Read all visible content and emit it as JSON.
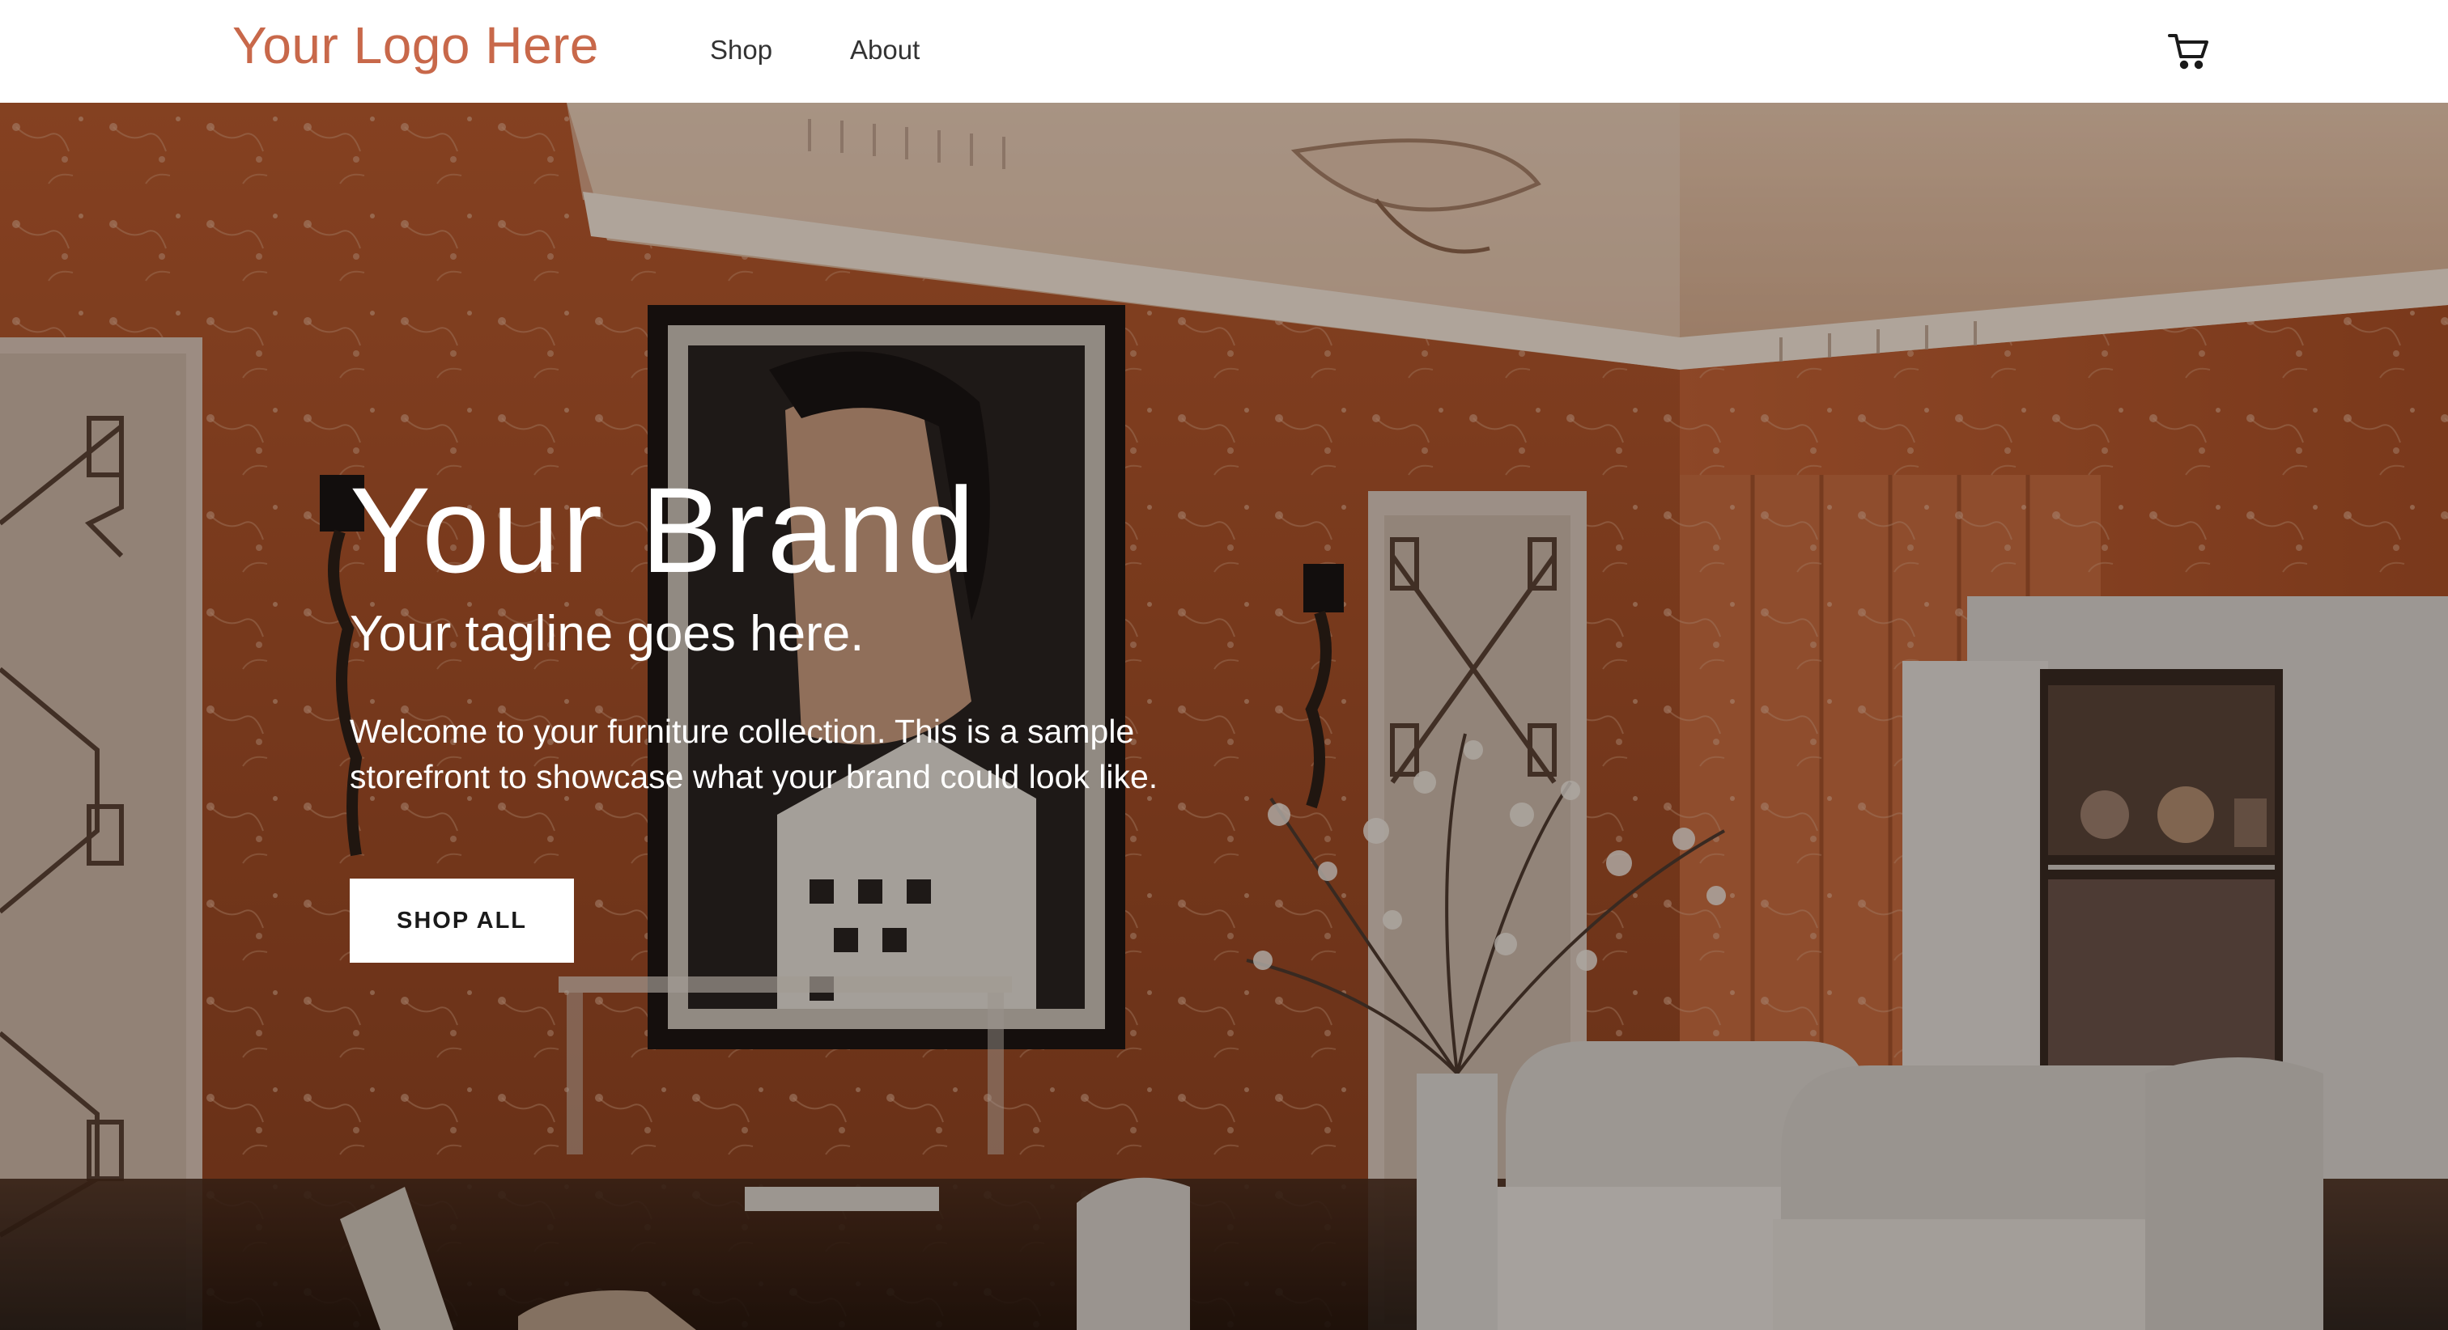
{
  "header": {
    "logo_text": "Your Logo Here",
    "nav": [
      {
        "label": "Shop"
      },
      {
        "label": "About"
      }
    ],
    "cart_icon": "shopping-cart-icon"
  },
  "hero": {
    "title": "Your Brand",
    "tagline": "Your tagline goes here.",
    "description": "Welcome to your furniture collection. This is a sample storefront to showcase what your brand could look like.",
    "cta_label": "SHOP ALL"
  },
  "colors": {
    "logo": "#c8684a",
    "nav_text": "#333333",
    "hero_text": "#ffffff",
    "cta_background": "#ffffff",
    "cta_text": "#1a1a1a",
    "wall_orange": "#b9582d"
  }
}
